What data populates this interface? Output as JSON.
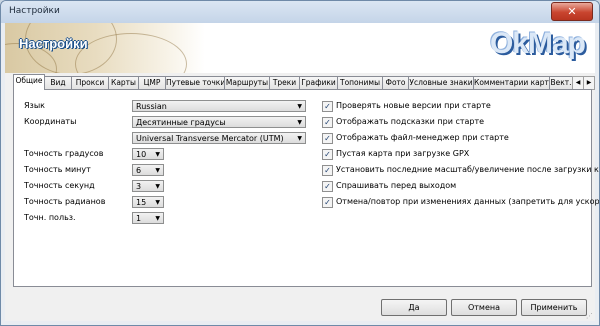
{
  "window": {
    "title": "Настройки",
    "close_label": "✕"
  },
  "banner": {
    "heading": "Настройки",
    "logo": "OkMap"
  },
  "tabs": [
    "Общие",
    "Вид",
    "Прокси",
    "Карты",
    "ЦМР",
    "Путевые точки",
    "Маршруты",
    "Треки",
    "Графики",
    "Топонимы",
    "Фото",
    "Условные знаки",
    "Комментарии карты",
    "Вект."
  ],
  "tab_scroll": {
    "left": "◀",
    "right": "▶"
  },
  "general": {
    "language_label": "Язык",
    "language_value": "Russian",
    "coords_label": "Координаты",
    "coords_value": "Десятинные градусы",
    "projection_value": "Universal Transverse Mercator (UTM)",
    "deg_precision_label": "Точность градусов",
    "deg_precision_value": "10",
    "min_precision_label": "Точность минут",
    "min_precision_value": "6",
    "sec_precision_label": "Точность секунд",
    "sec_precision_value": "3",
    "rad_precision_label": "Точность радианов",
    "rad_precision_value": "15",
    "user_precision_label": "Точн. польз.",
    "user_precision_value": "1"
  },
  "options": [
    {
      "label": "Проверять новые версии при старте",
      "checked": true
    },
    {
      "label": "Отображать подсказки при старте",
      "checked": true
    },
    {
      "label": "Отображать файл-менеджер при старте",
      "checked": true
    },
    {
      "label": "Пустая карта при загрузке GPX",
      "checked": true
    },
    {
      "label": "Установить последние масштаб/увеличение после загрузки карты",
      "checked": true
    },
    {
      "label": "Спрашивать перед выходом",
      "checked": true
    },
    {
      "label": "Отмена/повтор при изменениях данных (запретить для ускорения работы)",
      "checked": true
    }
  ],
  "buttons": {
    "ok": "Да",
    "cancel": "Отмена",
    "apply": "Применить"
  }
}
